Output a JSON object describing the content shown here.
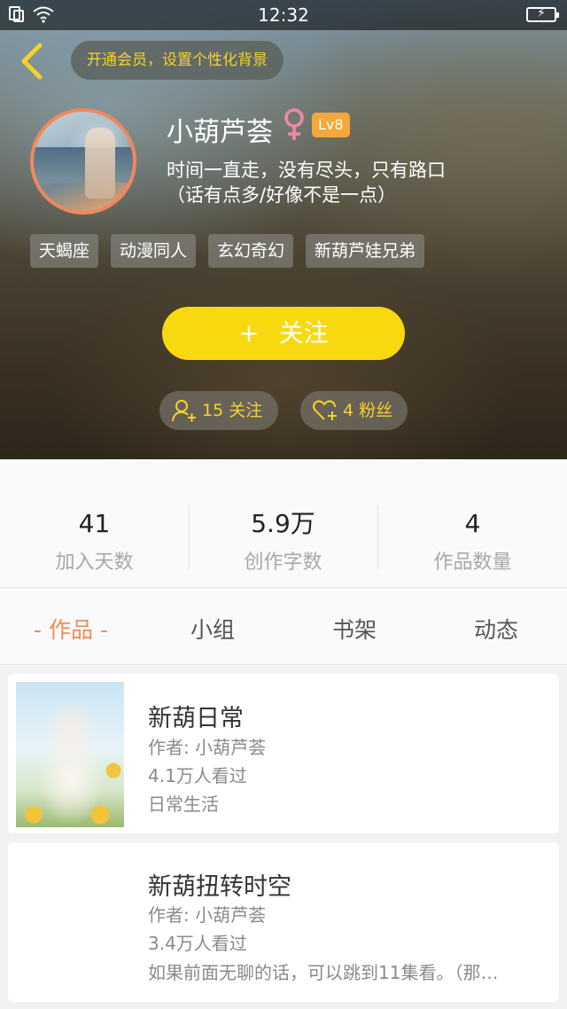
{
  "status_bar": {
    "time": "12:32"
  },
  "header": {
    "vip_prompt": "开通会员，设置个性化背景",
    "username": "小葫芦荟",
    "level": "Lv8",
    "bio_line1": "时间一直走，没有尽头，只有路口",
    "bio_line2": "（话有点多/好像不是一点）",
    "tags": [
      "天蝎座",
      "动漫同人",
      "玄幻奇幻",
      "新葫芦娃兄弟"
    ],
    "follow_button": {
      "plus": "+",
      "label": "关注"
    },
    "following": "15 关注",
    "fans": "4 粉丝"
  },
  "stats": [
    {
      "value": "41",
      "label": "加入天数"
    },
    {
      "value": "5.9万",
      "label": "创作字数"
    },
    {
      "value": "4",
      "label": "作品数量"
    }
  ],
  "tabs": [
    "- 作品 -",
    "小组",
    "书架",
    "动态"
  ],
  "works": [
    {
      "title": "新葫日常",
      "author": "作者: 小葫芦荟",
      "views": "4.1万人看过",
      "desc": "日常生活"
    },
    {
      "title": "新葫扭转时空",
      "author": "作者: 小葫芦荟",
      "views": "3.4万人看过",
      "desc": "如果前面无聊的话，可以跳到11集看。（那…"
    }
  ],
  "colors": {
    "accent_yellow": "#f8d90f",
    "tab_active": "#ef8b5a",
    "level_badge": "#f4a73a",
    "gender_pink": "#f08aa5"
  }
}
